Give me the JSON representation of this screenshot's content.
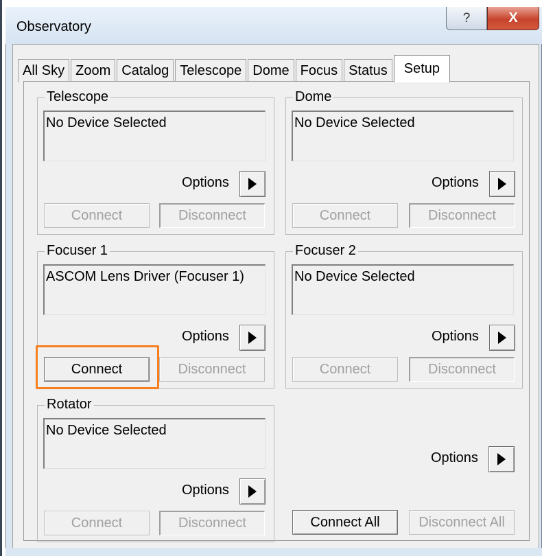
{
  "window": {
    "title": "Observatory",
    "help_glyph": "?",
    "close_glyph": "X"
  },
  "tabs": [
    {
      "label": "All Sky"
    },
    {
      "label": "Zoom"
    },
    {
      "label": "Catalog"
    },
    {
      "label": "Telescope"
    },
    {
      "label": "Dome"
    },
    {
      "label": "Focus"
    },
    {
      "label": "Status"
    },
    {
      "label": "Setup",
      "active": true
    }
  ],
  "groups": {
    "telescope": {
      "label": "Telescope",
      "device": "No Device Selected",
      "options": "Options",
      "connect": "Connect",
      "disconnect": "Disconnect"
    },
    "dome": {
      "label": "Dome",
      "device": "No Device Selected",
      "options": "Options",
      "connect": "Connect",
      "disconnect": "Disconnect"
    },
    "focuser1": {
      "label": "Focuser 1",
      "device": "ASCOM Lens Driver (Focuser 1)",
      "options": "Options",
      "connect": "Connect",
      "disconnect": "Disconnect"
    },
    "focuser2": {
      "label": "Focuser 2",
      "device": "No Device Selected",
      "options": "Options",
      "connect": "Connect",
      "disconnect": "Disconnect"
    },
    "rotator": {
      "label": "Rotator",
      "device": "No Device Selected",
      "options": "Options",
      "connect": "Connect",
      "disconnect": "Disconnect"
    }
  },
  "global": {
    "options": "Options",
    "connect_all": "Connect All",
    "disconnect_all": "Disconnect All"
  },
  "colors": {
    "highlight": "#f6801f",
    "close_button": "#c7432b"
  }
}
